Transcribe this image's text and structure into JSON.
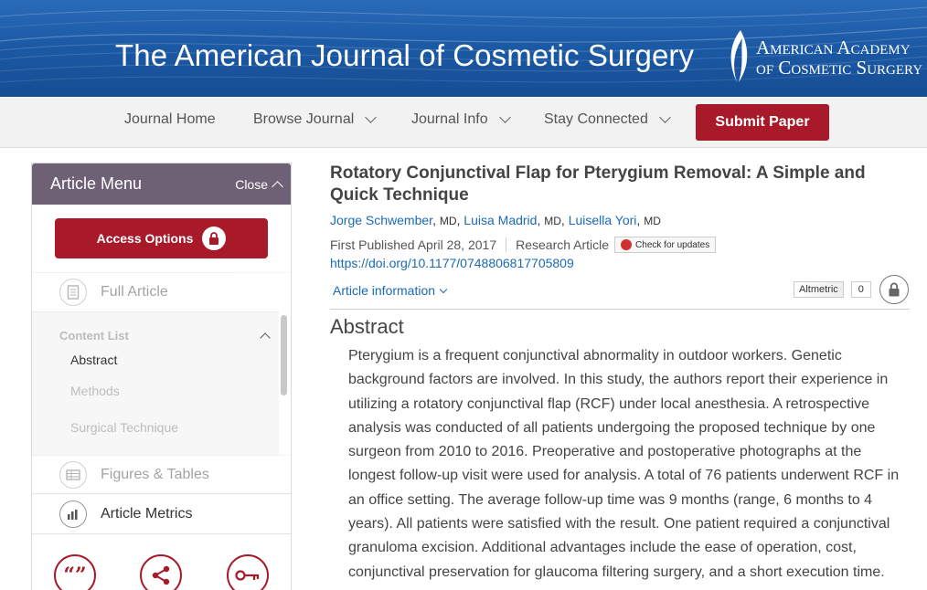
{
  "header": {
    "journal_title": "The American Journal of Cosmetic Surgery",
    "society_line1": "American Academy",
    "society_line2": "of Cosmetic Surgery"
  },
  "nav": {
    "items": [
      {
        "label": "Journal Home",
        "dropdown": false
      },
      {
        "label": "Browse Journal",
        "dropdown": true
      },
      {
        "label": "Journal Info",
        "dropdown": true
      },
      {
        "label": "Stay Connected",
        "dropdown": true
      }
    ],
    "submit_label": "Submit Paper"
  },
  "sidebar": {
    "title": "Article Menu",
    "close_label": "Close",
    "access_label": "Access Options",
    "full_article": "Full Article",
    "content_list": {
      "title": "Content List",
      "items": [
        "Abstract",
        "Methods",
        "Surgical Technique"
      ]
    },
    "figures_tables": "Figures & Tables",
    "article_metrics": "Article Metrics",
    "bottom_icons": [
      "quote-icon",
      "share-icon",
      "key-icon"
    ]
  },
  "article": {
    "title": "Rotatory Conjunctival Flap for Pterygium Removal: A Simple and Quick Technique",
    "authors": [
      {
        "name": "Jorge Schwember",
        "degree": "MD"
      },
      {
        "name": "Luisa Madrid",
        "degree": "MD"
      },
      {
        "name": "Luisella Yori",
        "degree": "MD"
      }
    ],
    "published": "First Published April 28, 2017",
    "type": "Research Article",
    "check_updates": "Check for updates",
    "doi": "https://doi.org/10.1177/0748806817705809",
    "info_label": "Article information",
    "altmetric_label": "Altmetric",
    "altmetric_count": "0",
    "abstract_heading": "Abstract",
    "abstract_text": "Pterygium is a frequent conjunctival abnormality in outdoor workers. Genetic background factors are involved. In this study, the authors report their experience in utilizing a rotatory conjunctival flap (RCF) under local anesthesia. A retrospective analysis was conducted of all patients undergoing the proposed technique by one surgeon from 2010 to 2016. Preoperative and postoperative photographs at the longest follow-up visit were used for analysis. A total of 76 patients underwent RCF in an office setting. The average follow-up time was 9 months (range, 6 months to 4 years). All patients were satisfied with the result. One patient required a conjunctival granuloma excision. Additional advantages include the ease of operation, cost, conjunctival preservation for glaucoma filtering surgery, and a short execution time."
  },
  "colors": {
    "banner": "#1c5aa6",
    "accent_red": "#a8192a",
    "menu_purple": "#6f6175",
    "link_blue": "#1b6ab5"
  }
}
